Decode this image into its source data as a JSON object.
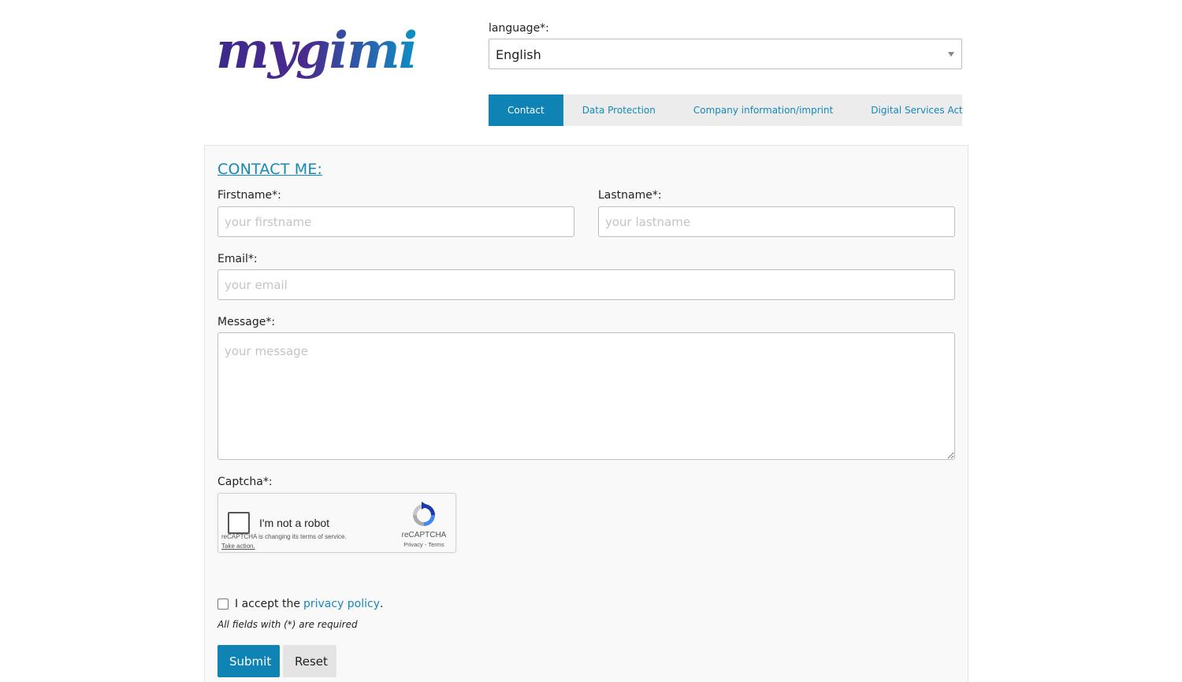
{
  "logo": {
    "text": "mygimi",
    "colors": [
      "#3d2a8c",
      "#0e8fc4"
    ]
  },
  "language": {
    "label": "language*:",
    "selected": "English"
  },
  "tabs": [
    {
      "label": "Contact",
      "active": true
    },
    {
      "label": "Data Protection",
      "active": false
    },
    {
      "label": "Company information/imprint",
      "active": false
    },
    {
      "label": "Digital Services Act",
      "active": false
    }
  ],
  "form": {
    "heading": "CONTACT ME:",
    "firstname": {
      "label": "Firstname*:",
      "placeholder": "your firstname"
    },
    "lastname": {
      "label": "Lastname*:",
      "placeholder": "your lastname"
    },
    "email": {
      "label": "Email*:",
      "placeholder": "your email"
    },
    "message": {
      "label": "Message*:",
      "placeholder": "your message"
    },
    "captcha": {
      "label": "Captcha*:",
      "checkbox_text": "I'm not a robot",
      "notice": "reCAPTCHA is changing its terms of service.",
      "action": "Take action.",
      "brand": "reCAPTCHA",
      "links": "Privacy - Terms"
    },
    "accept": {
      "prefix": "I accept the",
      "link": "privacy policy",
      "suffix": "."
    },
    "required_note": "All fields with (*) are required",
    "submit_label": "Submit",
    "reset_label": "Reset"
  },
  "colors": {
    "accent": "#0f83b4",
    "link": "#1489b9",
    "tab_bar": "#ececec"
  }
}
